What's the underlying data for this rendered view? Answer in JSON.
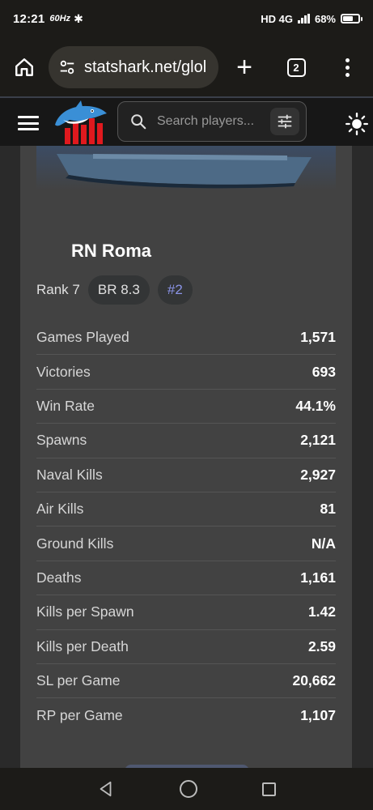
{
  "status_bar": {
    "time": "12:21",
    "refresh_rate": "60Hz",
    "network": "HD 4G",
    "battery": "68%",
    "battery_level": 0.68
  },
  "browser": {
    "url": "statshark.net/glol",
    "tab_count": "2"
  },
  "site_header": {
    "search_placeholder": "Search players..."
  },
  "vehicle": {
    "name": "RN Roma",
    "rank": "Rank 7",
    "br": "BR 8.3",
    "position": "#2"
  },
  "stats": [
    {
      "label": "Games Played",
      "value": "1,571"
    },
    {
      "label": "Victories",
      "value": "693"
    },
    {
      "label": "Win Rate",
      "value": "44.1%"
    },
    {
      "label": "Spawns",
      "value": "2,121"
    },
    {
      "label": "Naval Kills",
      "value": "2,927"
    },
    {
      "label": "Air Kills",
      "value": "81"
    },
    {
      "label": "Ground Kills",
      "value": "N/A"
    },
    {
      "label": "Deaths",
      "value": "1,161"
    },
    {
      "label": "Kills per Spawn",
      "value": "1.42"
    },
    {
      "label": "Kills per Death",
      "value": "2.59"
    },
    {
      "label": "SL per Game",
      "value": "20,662"
    },
    {
      "label": "RP per Game",
      "value": "1,107"
    }
  ],
  "colors": {
    "card": "#424242",
    "accent": "#8a93e6",
    "header": "#171717"
  }
}
